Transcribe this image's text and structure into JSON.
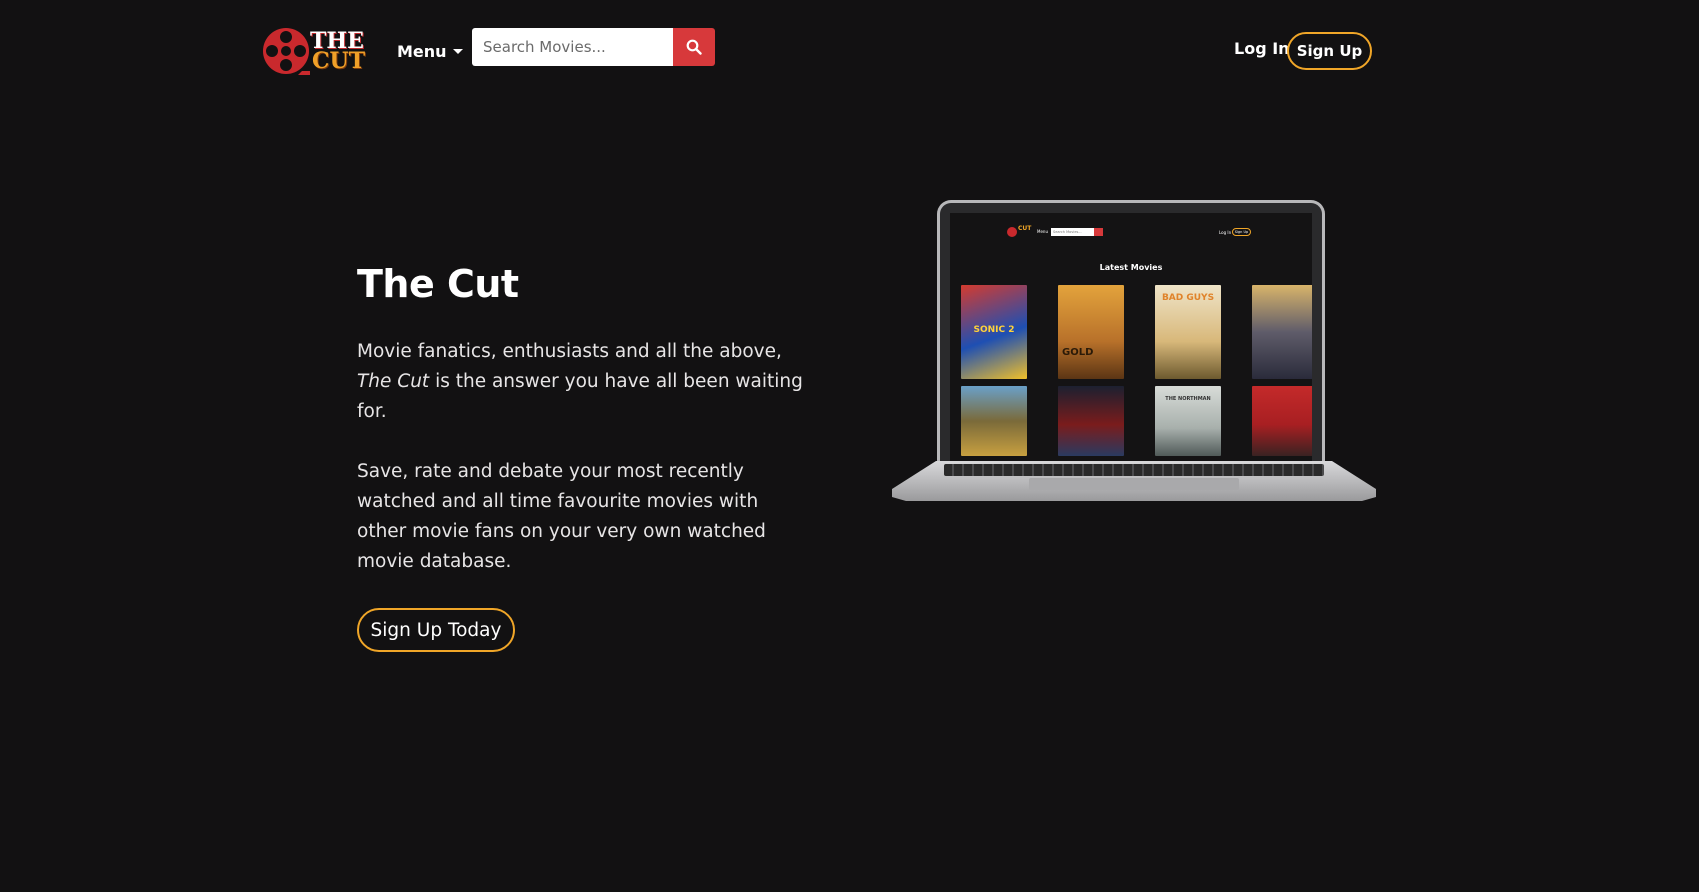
{
  "nav": {
    "logo_word_top": "THE",
    "logo_word_bottom": "CUT",
    "menu_label": "Menu",
    "search_placeholder": "Search Movies...",
    "login_label": "Log In",
    "signup_label": "Sign Up"
  },
  "hero": {
    "title": "The Cut",
    "paragraph1_start": "Movie fanatics, enthusiasts and all the above,",
    "paragraph1_em": "The Cut",
    "paragraph1_end": " is the answer you have all been waiting for.",
    "paragraph2": "Save, rate and debate your most recently watched and all time favourite movies with other movie fans on your very own watched movie database.",
    "cta_label": "Sign Up Today"
  },
  "laptop_screen": {
    "menu": "Menu",
    "search_placeholder": "Search Movies...",
    "login": "Log In",
    "signup": "Sign Up",
    "heading": "Latest Movies",
    "posters": [
      "SONIC 2",
      "GOLD",
      "BAD GUYS",
      "",
      "",
      "",
      "THE NORTHMAN",
      ""
    ]
  },
  "colors": {
    "background": "#121112",
    "accent_orange": "#f0a628",
    "search_red": "#d7393b"
  },
  "icons": [
    "film-reel-logo",
    "caret-down-icon",
    "search-icon"
  ]
}
